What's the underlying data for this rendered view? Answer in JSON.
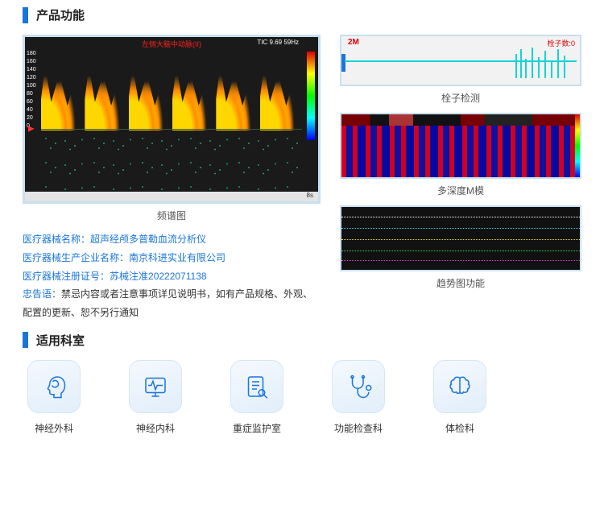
{
  "sections": {
    "features_title": "产品功能",
    "departments_title": "适用科室"
  },
  "figures": {
    "spectrum": {
      "caption": "频谱图",
      "inner_title": "左侧大脑中动脉(II)",
      "right_label": "TIC 9.69  59Hz",
      "footer_right": "8s"
    },
    "emboli": {
      "caption": "栓子检测",
      "left_label": "2M",
      "right_label": "栓子数:0"
    },
    "mmode": {
      "caption": "多深度M模"
    },
    "trend": {
      "caption": "趋势图功能"
    }
  },
  "info": {
    "line1_label": "医疗器械名称：",
    "line1_value": "超声经颅多普勒血流分析仪",
    "line2_label": "医疗器械生产企业名称：",
    "line2_value": "南京科进实业有限公司",
    "line3_label": "医疗器械注册证号：",
    "line3_value": "苏械注准20222071138",
    "line4_label": "忠告语：",
    "line4_value": "禁忌内容或者注意事项详见说明书，如有产品规格、外观、配置的更新、恕不另行通知"
  },
  "departments": [
    {
      "icon": "brain-head-icon",
      "label": "神经外科"
    },
    {
      "icon": "ecg-monitor-icon",
      "label": "神经内科"
    },
    {
      "icon": "clipboard-search-icon",
      "label": "重症监护室"
    },
    {
      "icon": "stethoscope-icon",
      "label": "功能检查科"
    },
    {
      "icon": "brain-icon",
      "label": "体检科"
    }
  ]
}
